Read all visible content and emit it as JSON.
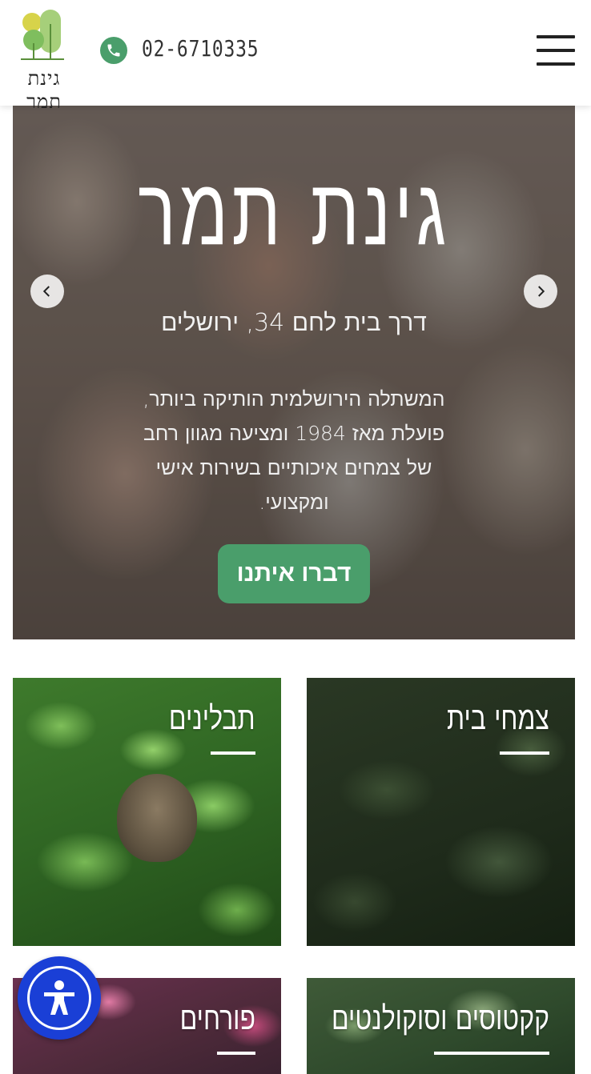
{
  "header": {
    "logo_text": "גינת תמר",
    "phone_number": "02-6710335",
    "phone_icon": "phone-icon",
    "menu_icon": "hamburger-menu-icon"
  },
  "hero": {
    "title": "גינת תמר",
    "address": "דרך בית לחם 34, ירושלים",
    "description": "המשתלה הירושלמית הותיקה ביותר, פועלת מאז 1984 ומציעה מגוון רחב של צמחים איכותיים בשירות אישי ומקצועי.",
    "cta_label": "דברו איתנו",
    "prev_icon": "chevron-left-icon",
    "next_icon": "chevron-right-icon"
  },
  "categories": [
    {
      "label": "תבלינים"
    },
    {
      "label": "צמחי בית"
    },
    {
      "label": "פורחים"
    },
    {
      "label": "קקטוסים וסוקולנטים"
    }
  ],
  "accessibility": {
    "icon": "accessibility-icon"
  },
  "colors": {
    "brand_green": "#4a9e6b",
    "accessibility_blue": "#1a3fd6",
    "logo_yellow": "#d7d34a",
    "logo_green": "#8cc063"
  }
}
